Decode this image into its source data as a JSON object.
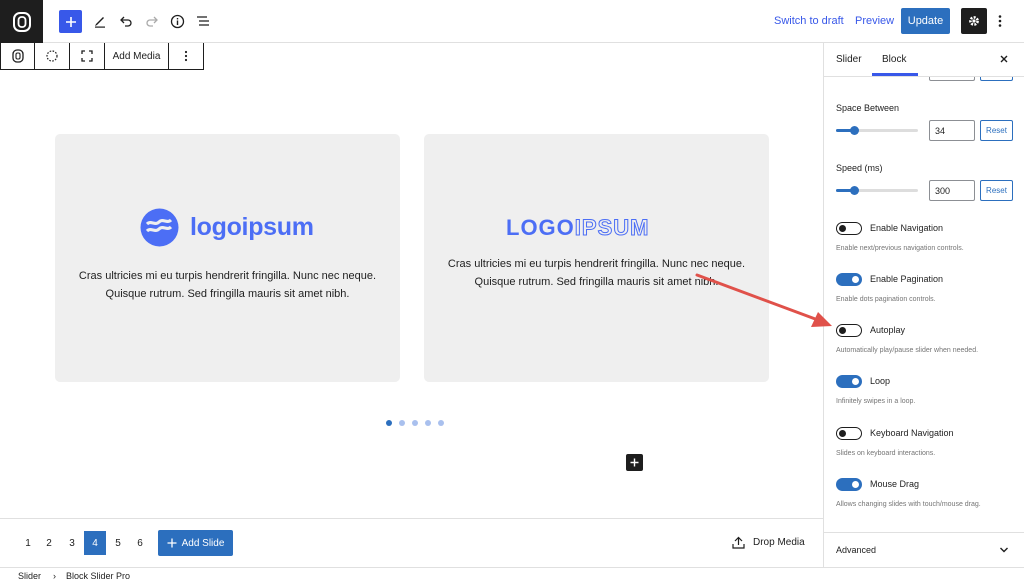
{
  "header": {
    "switch_to_draft": "Switch to draft",
    "preview": "Preview",
    "update": "Update"
  },
  "block_toolbar": {
    "add_media": "Add Media"
  },
  "slides": [
    {
      "logo_text": "logoipsum",
      "text_line1": "Cras ultricies mi eu turpis hendrerit fringilla. Nunc nec neque.",
      "text_line2": "Quisque rutrum. Sed fringilla mauris sit amet nibh."
    },
    {
      "logo_text_dark": "LOGO",
      "logo_text_light": "IPSUM",
      "text_line1": "Cras ultricies mi eu turpis hendrerit fringilla. Nunc nec neque.",
      "text_line2": "Quisque rutrum. Sed fringilla mauris sit amet nibh."
    }
  ],
  "pagination": {
    "pages": [
      "1",
      "2",
      "3",
      "4",
      "5",
      "6"
    ],
    "active_page": "4",
    "add_slide": "Add Slide",
    "drop_media": "Drop Media"
  },
  "breadcrumb": {
    "items": [
      "Slider",
      "Block Slider Pro"
    ],
    "separator": "›"
  },
  "sidebar": {
    "tabs": [
      "Slider",
      "Block"
    ],
    "active_tab": "Block",
    "space_between": {
      "label": "Space Between",
      "value": "34",
      "reset": "Reset",
      "fraction": 0.22
    },
    "speed": {
      "label": "Speed (ms)",
      "value": "300",
      "reset": "Reset",
      "fraction": 0.22
    },
    "toggles": [
      {
        "label": "Enable Navigation",
        "help": "Enable next/previous navigation controls.",
        "on": false
      },
      {
        "label": "Enable Pagination",
        "help": "Enable dots pagination controls.",
        "on": true
      },
      {
        "label": "Autoplay",
        "help": "Automatically play/pause slider when needed.",
        "on": false
      },
      {
        "label": "Loop",
        "help": "Infinitely swipes in a loop.",
        "on": true
      },
      {
        "label": "Keyboard Navigation",
        "help": "Slides on keyboard interactions.",
        "on": false
      },
      {
        "label": "Mouse Drag",
        "help": "Allows changing slides with touch/mouse drag.",
        "on": true
      }
    ],
    "advanced": "Advanced"
  },
  "colors": {
    "accent": "#2c6fbe",
    "logo_blue": "#4c6ef5",
    "annotation_arrow": "#e0514a"
  },
  "icons": [
    "wordpress-logo-icon",
    "plus-icon",
    "pen-icon",
    "undo-icon",
    "redo-icon",
    "info-icon",
    "list-view-icon",
    "gear-icon",
    "more-vertical-icon",
    "slider-block-icon",
    "circle-dashed-icon",
    "fullscreen-icon",
    "close-icon",
    "chevron-down-icon",
    "upload-icon"
  ]
}
